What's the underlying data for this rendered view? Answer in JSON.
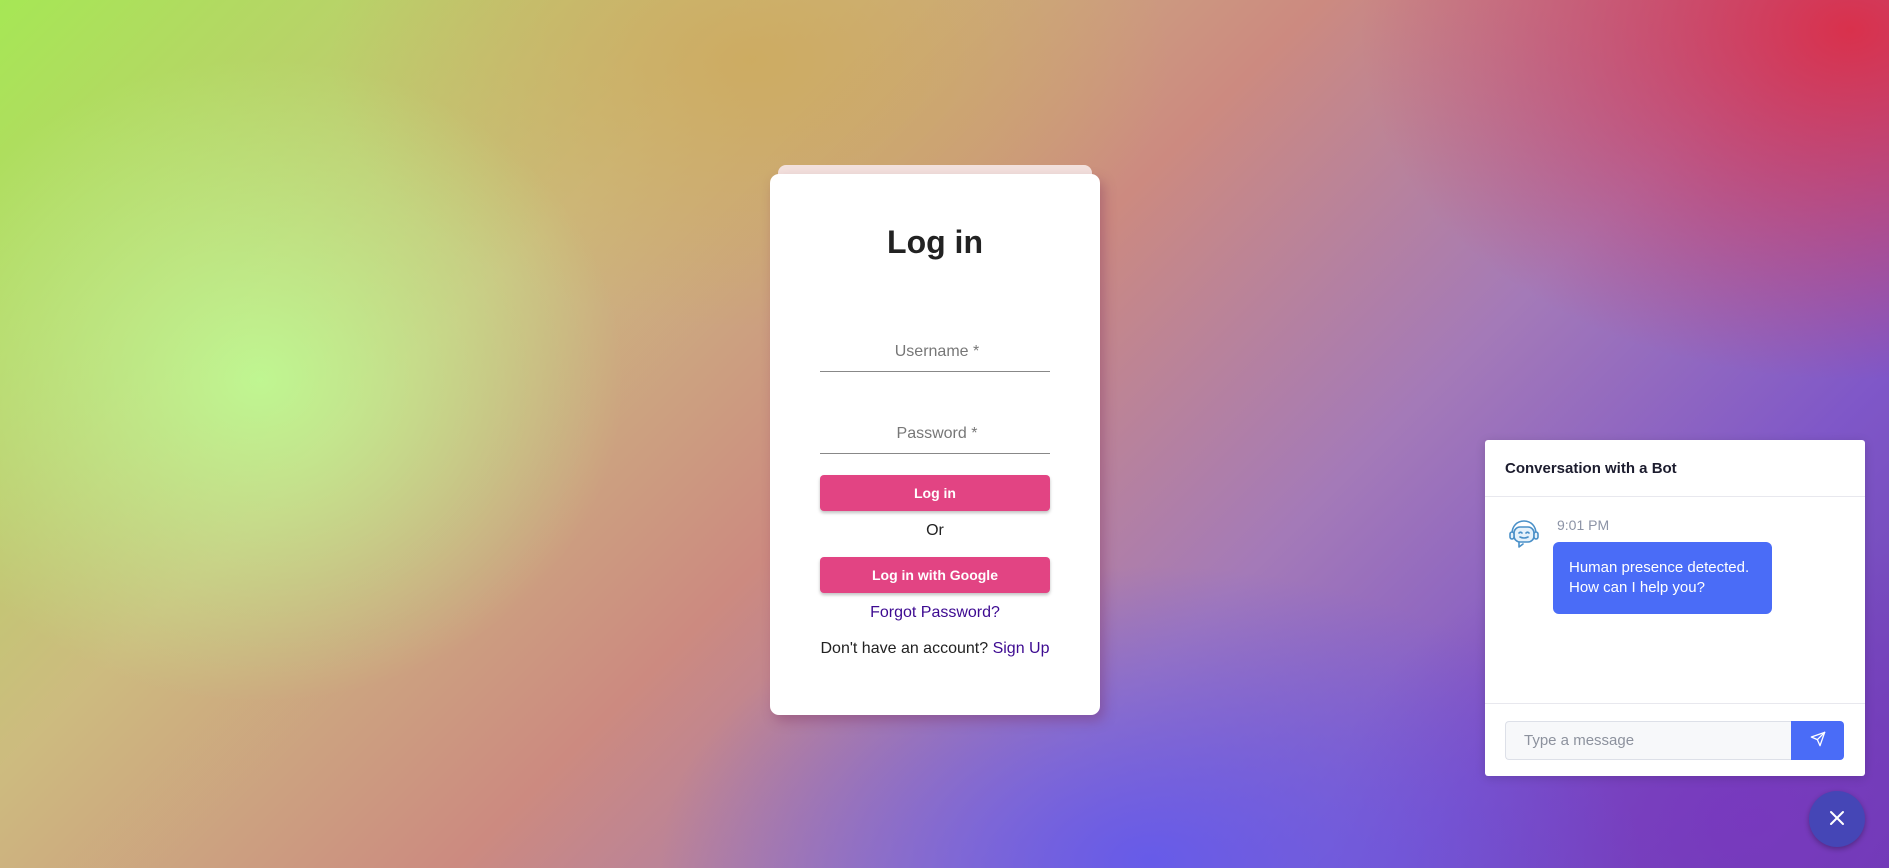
{
  "login": {
    "title": "Log in",
    "username_placeholder": "Username *",
    "password_placeholder": "Password *",
    "login_button": "Log in",
    "or_text": "Or",
    "google_button": "Log in with Google",
    "forgot_link": "Forgot Password?",
    "signup_prompt": "Don't have an account?",
    "signup_link": "Sign Up"
  },
  "chat": {
    "title": "Conversation with a Bot",
    "messages": [
      {
        "time": "9:01 PM",
        "lines": [
          "Human presence detected.",
          "How can I help you?"
        ]
      }
    ],
    "input_placeholder": "Type a message",
    "avatar_icon": "robot-icon",
    "send_icon": "send-icon",
    "close_icon": "close-icon",
    "accent_color": "#4a6cf7"
  },
  "colors": {
    "primary_button": "#e24483",
    "link": "#3d0a91",
    "close_fab": "#4546b6"
  }
}
